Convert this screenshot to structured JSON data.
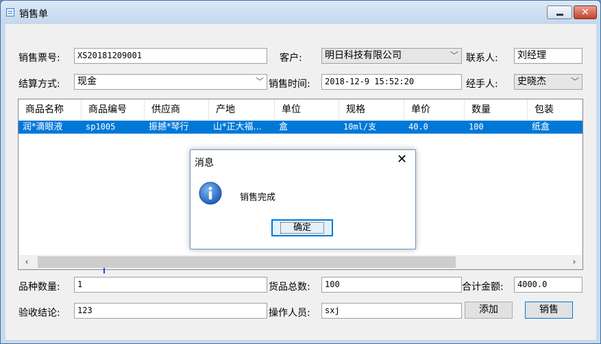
{
  "window": {
    "title": "销售单"
  },
  "form": {
    "ticket_label": "销售票号:",
    "ticket_value": "XS20181209001",
    "customer_label": "客户:",
    "customer_value": "明日科技有限公司",
    "contact_label": "联系人:",
    "contact_value": "刘经理",
    "settlement_label": "结算方式:",
    "settlement_value": "现金",
    "time_label": "销售时间:",
    "time_value": "2018-12-9 15:52:20",
    "handler_label": "经手人:",
    "handler_value": "史晓杰"
  },
  "table": {
    "columns": [
      "商品名称",
      "商品编号",
      "供应商",
      "产地",
      "单位",
      "规格",
      "单价",
      "数量",
      "包装"
    ],
    "rows": [
      [
        "润*滴眼液",
        "sp1005",
        "振撼*琴行",
        "山*正大福...",
        "盒",
        "10ml/支",
        "40.0",
        "100",
        "纸盒"
      ]
    ]
  },
  "footer": {
    "variety_label": "品种数量:",
    "variety_value": "1",
    "total_qty_label": "货品总数:",
    "total_qty_value": "100",
    "total_amount_label": "合计金额:",
    "total_amount_value": "4000.0",
    "acceptance_label": "验收结论:",
    "acceptance_value": "123",
    "operator_label": "操作人员:",
    "operator_value": "sxj",
    "add_label": "添加",
    "sell_label": "销售"
  },
  "dialog": {
    "title": "消息",
    "message": "销售完成",
    "ok_label": "确定"
  },
  "icons": {
    "info": "info-icon",
    "close": "close-icon",
    "minimize": "minimize-icon"
  },
  "colors": {
    "selection": "#0078d7",
    "close_button": "#c7412b"
  }
}
